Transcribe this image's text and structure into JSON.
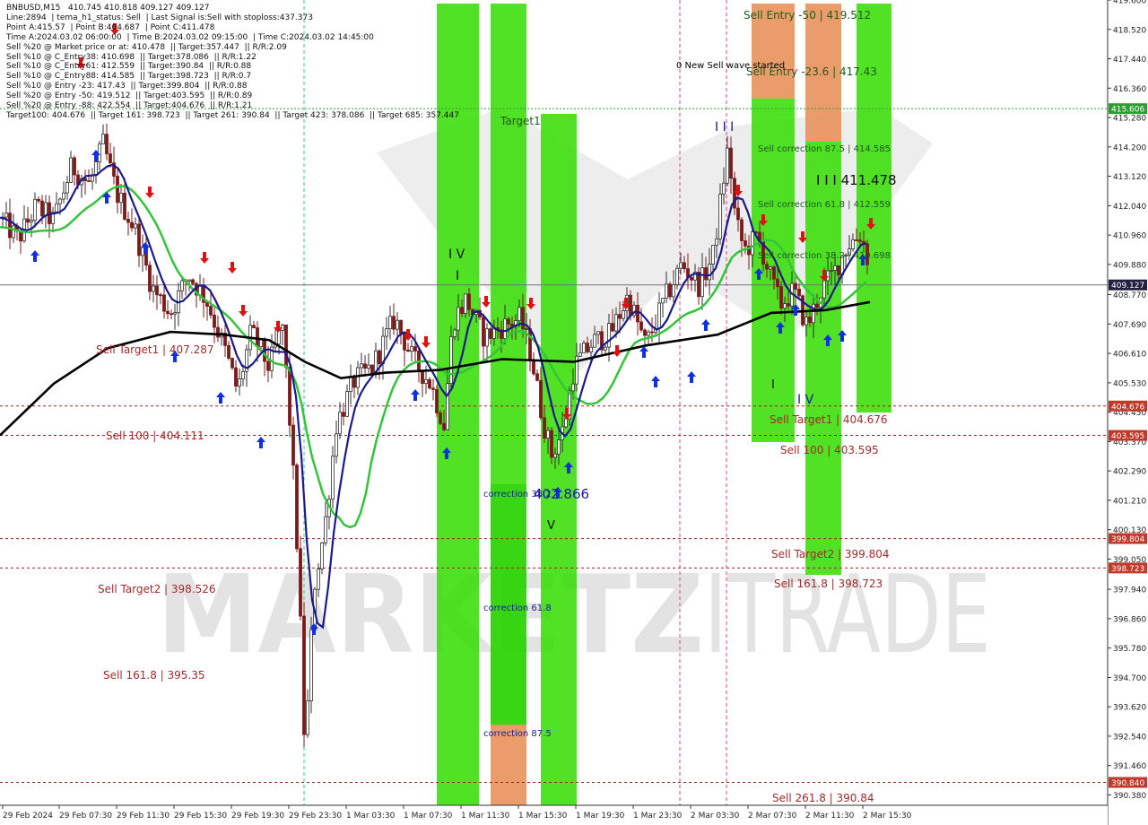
{
  "header": {
    "lines": [
      "BNBUSD,M15   410.745 410.818 409.127 409.127",
      "Line:2894  | tema_h1_status: Sell  | Last Signal is:Sell with stoploss:437.373",
      "Point A:415.57  | Point B:404.687  | Point C:411.478",
      "Time A:2024.03.02 06:00:00  | Time B:2024.03.02 09:15:00  | Time C:2024.03.02 14:45:00",
      "Sell %20 @ Market price or at: 410.478  || Target:357.447  || R/R:2.09",
      "Sell %10 @ C_Entry38: 410.698  || Target:378.086  || R/R:1.22",
      "Sell %10 @ C_Entry61: 412.559  || Target:390.84  || R/R:0.88",
      "Sell %10 @ C_Entry88: 414.585  || Target:398.723  || R/R:0.7",
      "Sell %10 @ Entry -23: 417.43  || Target:399.804  || R/R:0.88",
      "Sell %20 @ Entry -50: 419.512  || Target:403.595  || R/R:0.89",
      "Sell %20 @ Entry -88: 422.554  || Target:404.676  || R/R:1.21",
      "Target100: 404.676  || Target 161: 398.723  || Target 261: 390.84  || Target 423: 378.086  || Target 685: 357.447"
    ]
  },
  "colors": {
    "background": "#ffffff",
    "bull_candle": "#2f2f2f",
    "bear_candle": "#7a1a1a",
    "green_zone": "#33dd00",
    "orange_zone": "#e8925a",
    "level_line": "#a02020",
    "level_label_bg": "#c0392b",
    "blue_ma": "#1a1a8c",
    "green_ma": "#33c43a",
    "black_ma": "#000000",
    "up_arrow": "#1030e0",
    "down_arrow": "#e01010",
    "current_price_bg": "#202040",
    "fib_text": "#1a1aa0",
    "wave_text": "#1a1a8c",
    "green_price_bg": "#2e9e33"
  },
  "chart_data": {
    "type": "candlestick",
    "symbol": "BNBUSD",
    "timeframe": "M15",
    "ylim": [
      390.0,
      419.6
    ],
    "y_ticks": [
      419.6,
      418.52,
      417.44,
      416.36,
      415.28,
      414.2,
      413.12,
      412.04,
      410.96,
      409.88,
      408.77,
      407.69,
      406.61,
      405.53,
      404.45,
      403.37,
      402.29,
      401.21,
      400.13,
      399.05,
      397.94,
      396.86,
      395.78,
      394.7,
      393.62,
      392.54,
      391.46,
      390.38
    ],
    "x_labels": [
      "29 Feb 2024",
      "29 Feb 07:30",
      "29 Feb 11:30",
      "29 Feb 15:30",
      "29 Feb 19:30",
      "29 Feb 23:30",
      "1 Mar 03:30",
      "1 Mar 07:30",
      "1 Mar 11:30",
      "1 Mar 15:30",
      "1 Mar 19:30",
      "1 Mar 23:30",
      "2 Mar 03:30",
      "2 Mar 07:30",
      "2 Mar 11:30",
      "2 Mar 15:30"
    ],
    "current_price": "409.127",
    "price_tags": [
      {
        "value": 415.606,
        "label": "415.606",
        "color": "#2e9e33"
      },
      {
        "value": 404.676,
        "label": "404.676",
        "color": "#c0392b"
      },
      {
        "value": 403.595,
        "label": "403.595",
        "color": "#c0392b"
      },
      {
        "value": 399.804,
        "label": "399.804",
        "color": "#c0392b"
      },
      {
        "value": 398.723,
        "label": "398.723",
        "color": "#c0392b"
      },
      {
        "value": 390.84,
        "label": "390.840",
        "color": "#c0392b"
      }
    ],
    "level_labels": [
      {
        "text": "Sell Target1 | 407.287",
        "value": 407.287,
        "side": "left"
      },
      {
        "text": "Sell 100 | 404.111",
        "value": 404.111,
        "side": "left"
      },
      {
        "text": "Sell Target2 | 398.526",
        "value": 398.526,
        "side": "left"
      },
      {
        "text": "Sell 161.8 | 395.35",
        "value": 395.35,
        "side": "left"
      },
      {
        "text": "Sell Entry -50 | 419.512",
        "value": 419.512,
        "side": "right"
      },
      {
        "text": "Sell Entry -23.6 | 417.43",
        "value": 417.43,
        "side": "right"
      },
      {
        "text": "Sell correction 87.5 | 414.585",
        "value": 414.585,
        "side": "right"
      },
      {
        "text": "Sell correction 61.8 | 412.559",
        "value": 412.559,
        "side": "right"
      },
      {
        "text": "Sell correction 38.2 | 410.698",
        "value": 410.698,
        "side": "right"
      },
      {
        "text": "Sell Target1 | 404.676",
        "value": 404.676,
        "side": "right"
      },
      {
        "text": "Sell 100 | 403.595",
        "value": 403.595,
        "side": "right"
      },
      {
        "text": "Sell Target2 | 399.804",
        "value": 399.804,
        "side": "right"
      },
      {
        "text": "Sell 161.8 | 398.723",
        "value": 398.723,
        "side": "right"
      },
      {
        "text": "Sell 261.8 | 390.84",
        "value": 390.84,
        "side": "right"
      }
    ],
    "annotations": [
      {
        "text": "0 New Sell wave started",
        "value": 417.6
      },
      {
        "text": "I I I  411.478",
        "value": 412.6
      },
      {
        "text": "I I I",
        "value": 415.2
      },
      {
        "text": "I V",
        "value": 409.6
      },
      {
        "text": "I",
        "value": 409.0
      },
      {
        "text": "I",
        "value": 405.7
      },
      {
        "text": "I V",
        "value": 405.2
      },
      {
        "text": "V",
        "value": 400.8
      },
      {
        "text": "Target1",
        "value": 415.3
      },
      {
        "text": "correction 38.2",
        "value": 402.0
      },
      {
        "text": "402.866",
        "value": 402.0
      },
      {
        "text": "correction 61.8",
        "value": 397.5
      },
      {
        "text": "correction 87.5",
        "value": 393.1
      }
    ],
    "watermark": "MARKETZITRADE"
  }
}
